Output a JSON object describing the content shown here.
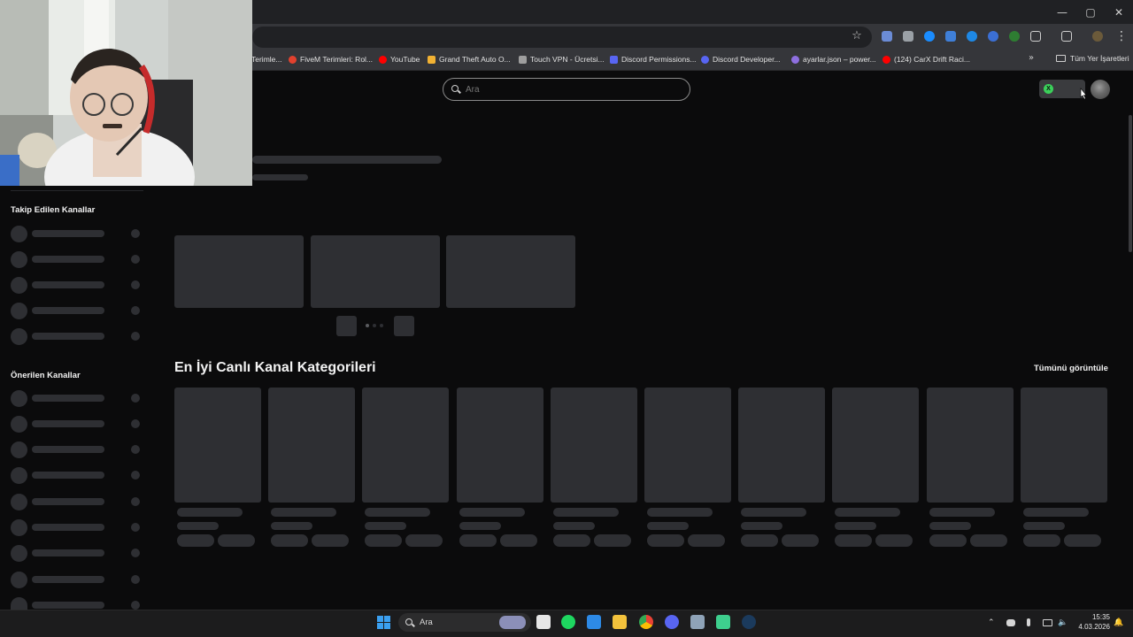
{
  "browser": {
    "window_controls": {
      "minimize": "—",
      "maximize": "▢",
      "close": "✕"
    },
    "star_icon": "☆",
    "menu_icon": "⋮",
    "bookmarks": [
      {
        "label": "Terimle...",
        "icon_color": "#5a5a5a"
      },
      {
        "label": "FiveM Terimleri: Rol...",
        "icon_color": "#e2412e"
      },
      {
        "label": "YouTube",
        "icon_color": "#ff0000"
      },
      {
        "label": "Grand Theft Auto O...",
        "icon_color": "#f2b233"
      },
      {
        "label": "Touch VPN - Ücretsi...",
        "icon_color": "#9e9e9e"
      },
      {
        "label": "Discord Permissions...",
        "icon_color": "#5865f2"
      },
      {
        "label": "Discord Developer...",
        "icon_color": "#5865f2"
      },
      {
        "label": "ayarlar.json – power...",
        "icon_color": "#8e6fe0"
      },
      {
        "label": "(124) CarX Drift Raci...",
        "icon_color": "#ff0000"
      }
    ],
    "bookmarks_more": "»",
    "all_bookmarks": "Tüm Yer İşaretleri"
  },
  "page": {
    "search": {
      "placeholder": "Ara"
    },
    "xbox_badge": "X",
    "sidebar": {
      "followed_title": "Takip Edilen Kanallar",
      "recommended_title": "Önerilen Kanallar"
    },
    "categories": {
      "title": "En İyi Canlı Kanal Kategorileri",
      "view_all": "Tümünü görüntüle"
    }
  },
  "taskbar": {
    "search_label": "Ara",
    "time": "15:35",
    "date": "4.03.2026",
    "tray_chevron": "⌃",
    "speaker_icon": "🔈",
    "notification_icon": "🔔"
  }
}
